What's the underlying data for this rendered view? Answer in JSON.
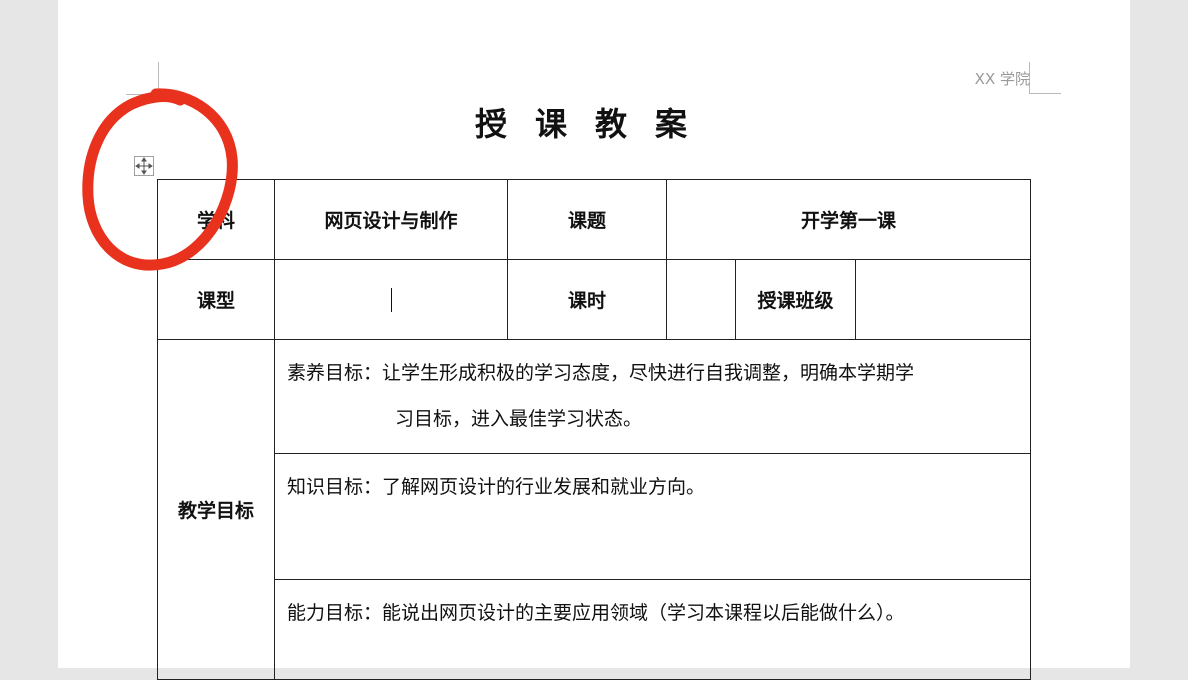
{
  "header": {
    "right_text": "XX 学院"
  },
  "document": {
    "title": "授课教案"
  },
  "table": {
    "row1": {
      "subject_label": "学科",
      "subject_value": "网页设计与制作",
      "topic_label": "课题",
      "topic_value": "开学第一课"
    },
    "row2": {
      "type_label": "课型",
      "type_value": "",
      "hours_label": "课时",
      "hours_value": "",
      "class_label": "授课班级",
      "class_value": ""
    },
    "goals": {
      "label": "教学目标",
      "literacy_line1": "素养目标：让学生形成积极的学习态度，尽快进行自我调整，明确本学期学",
      "literacy_line2": "习目标，进入最佳学习状态。",
      "knowledge": "知识目标：了解网页设计的行业发展和就业方向。",
      "ability": "能力目标：能说出网页设计的主要应用领域（学习本课程以后能做什么）。"
    }
  },
  "annotation": {
    "color": "#e8321e"
  },
  "icons": {
    "table_move": "move-arrows-icon"
  }
}
